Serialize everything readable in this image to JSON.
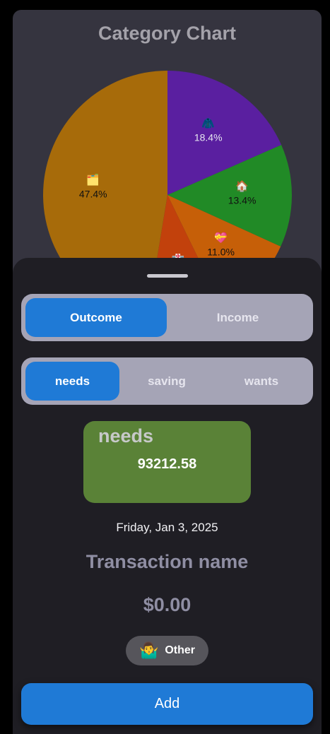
{
  "chart": {
    "title": "Category Chart",
    "colors": {
      "card_bg": "#35343f",
      "label_text": "#e6e6f0",
      "label_text_dark": "#111111"
    },
    "chart_data": {
      "type": "pie",
      "title": "Category Chart",
      "slices": [
        {
          "icon": "🧥",
          "value": 18.4,
          "label": "18.4%",
          "color": "#5a1fa0"
        },
        {
          "icon": "🏠",
          "value": 13.4,
          "label": "13.4%",
          "color": "#218a26"
        },
        {
          "icon": "💝",
          "value": 11.0,
          "label": "11.0%",
          "color": "#c65f08"
        },
        {
          "icon": "🏥",
          "value": 9.8,
          "label": "",
          "color": "#c2410c"
        },
        {
          "icon": "🗂️",
          "value": 47.4,
          "label": "47.4%",
          "color": "#a76b0a"
        }
      ]
    }
  },
  "type_toggle": {
    "options": [
      {
        "label": "Outcome",
        "active": true
      },
      {
        "label": "Income",
        "active": false
      }
    ]
  },
  "category_toggle": {
    "options": [
      {
        "label": "needs",
        "active": true
      },
      {
        "label": "saving",
        "active": false
      },
      {
        "label": "wants",
        "active": false
      }
    ]
  },
  "budget": {
    "label": "needs",
    "amount": "93212.58",
    "color": "#5a8237"
  },
  "date": "Friday, Jan 3, 2025",
  "transaction": {
    "name_placeholder": "Transaction name",
    "amount_placeholder": "$0.00"
  },
  "category_chip": {
    "icon": "🤷‍♂️",
    "label": "Other"
  },
  "add_button": {
    "label": "Add",
    "color": "#1f7ad6"
  }
}
